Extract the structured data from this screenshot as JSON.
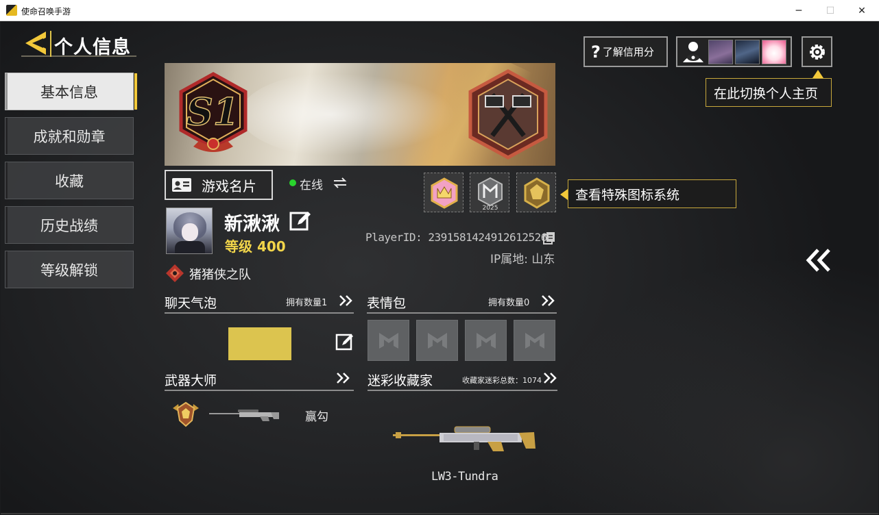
{
  "window": {
    "title": "使命召唤手游",
    "minimize": "─",
    "maximize": "☐",
    "close": "✕"
  },
  "header": {
    "title": "个人信息"
  },
  "sidebar": {
    "items": [
      {
        "label": "基本信息",
        "active": true
      },
      {
        "label": "成就和勋章",
        "active": false
      },
      {
        "label": "收藏",
        "active": false
      },
      {
        "label": "历史战绩",
        "active": false
      },
      {
        "label": "等级解锁",
        "active": false
      }
    ]
  },
  "banner": {
    "season_badge": "S1"
  },
  "profile": {
    "card_button": "游戏名片",
    "status": "在线",
    "status_color": "#29d42d",
    "name": "新湫湫",
    "level": "等级 400",
    "player_id": "PlayerID: 2391581424912612526",
    "ip": "IP属地: 山东",
    "team": "猪猪侠之队",
    "badge_year": "2025"
  },
  "tips": {
    "special_icons": "查看特殊图标系统",
    "switch_home": "在此切换个人主页"
  },
  "top_bar": {
    "credit_icon": "?",
    "credit_label": "了解信用分"
  },
  "sections": {
    "chat_bubble": {
      "title": "聊天气泡",
      "meta": "拥有数量1",
      "swatch_color": "#dcc44f"
    },
    "emotes": {
      "title": "表情包",
      "meta": "拥有数量0"
    },
    "weapon_master": {
      "title": "武器大师",
      "weapon": "赢勾"
    },
    "camo_collector": {
      "title": "迷彩收藏家",
      "meta": "收藏家迷彩总数：1074",
      "weapon": "LW3-Tundra"
    }
  },
  "colors": {
    "accent": "#f2c83a",
    "level": "#f2d54a"
  },
  "icons": [
    "back-arrow-icon",
    "id-card-icon",
    "swap-icon",
    "edit-icon",
    "copy-icon",
    "team-emblem-icon",
    "chevron-double-right-icon",
    "gear-icon",
    "eye-profile-icon",
    "double-chevron-left-icon",
    "emote-placeholder-icon"
  ]
}
